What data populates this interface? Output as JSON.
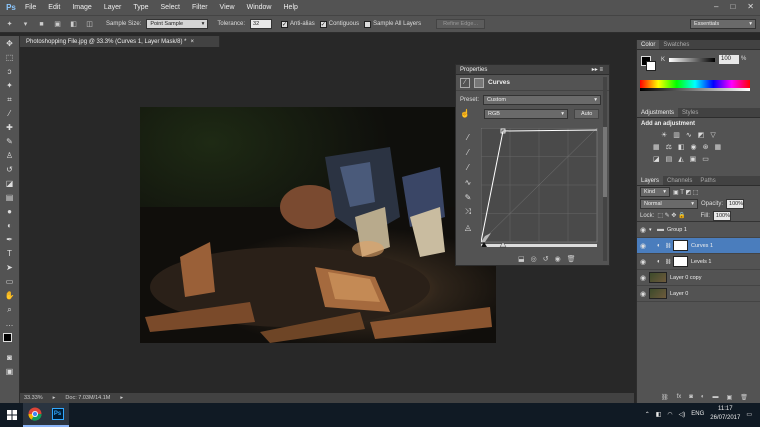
{
  "menubar": {
    "logo": "Ps",
    "items": [
      "File",
      "Edit",
      "Image",
      "Layer",
      "Type",
      "Select",
      "Filter",
      "View",
      "Window",
      "Help"
    ],
    "window_controls": [
      "–",
      "□",
      "✕"
    ]
  },
  "options": {
    "sample_size_label": "Sample Size:",
    "sample_size_value": "Point Sample",
    "tolerance_label": "Tolerance:",
    "tolerance_value": "32",
    "anti_alias_label": "Anti-alias",
    "contiguous_label": "Contiguous",
    "sample_all_label": "Sample All Layers",
    "refine_edge_label": "Refine Edge...",
    "workspace_value": "Essentials"
  },
  "document": {
    "tab_title": "Photoshopping File.jpg @ 33.3% (Curves 1, Layer Mask/8) *",
    "tab_close": "×",
    "zoom": "33.33%",
    "doc_info": "Doc: 7.03M/14.1M"
  },
  "properties": {
    "panel_title": "Properties",
    "adjustment_name": "Curves",
    "preset_label": "Preset:",
    "preset_value": "Custom",
    "channel_value": "RGB",
    "auto_label": "Auto"
  },
  "color_panel": {
    "tabs": [
      "Color",
      "Swatches"
    ],
    "k_label": "K",
    "k_value": "100",
    "percent": "%"
  },
  "adjustments_panel": {
    "tabs": [
      "Adjustments",
      "Styles"
    ],
    "heading": "Add an adjustment"
  },
  "layers_panel": {
    "tabs": [
      "Layers",
      "Channels",
      "Paths"
    ],
    "filter_kind": "Kind",
    "blend_mode": "Normal",
    "opacity_label": "Opacity:",
    "opacity_value": "100%",
    "lock_label": "Lock:",
    "fill_label": "Fill:",
    "fill_value": "100%",
    "layers": [
      {
        "name": "Group 1"
      },
      {
        "name": "Curves 1"
      },
      {
        "name": "Levels 1"
      },
      {
        "name": "Layer 0 copy"
      },
      {
        "name": "Layer 0"
      }
    ]
  },
  "taskbar": {
    "language": "ENG",
    "time": "11:17",
    "date": "26/07/2017"
  },
  "colors": {
    "ui_dark": "#535353",
    "ui_darker": "#424242",
    "accent": "#4a7dbd",
    "ps_blue": "#8cc8ff"
  }
}
